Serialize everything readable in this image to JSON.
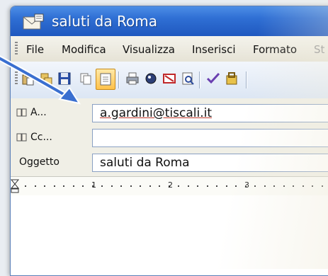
{
  "window": {
    "title": "saluti da Roma"
  },
  "menubar": {
    "items": [
      "File",
      "Modifica",
      "Visualizza",
      "Inserisci",
      "Formato",
      "St"
    ]
  },
  "toolbar": {
    "buttons": [
      "paste-icon",
      "cut-icon",
      "save-icon",
      "copy-icon",
      "attach-icon",
      "print-icon",
      "spell-icon",
      "delete-icon",
      "preview-icon",
      "check-icon",
      "permission-icon"
    ]
  },
  "headers": {
    "to_label": "A...",
    "to_value": "a.gardini@tiscali.it",
    "cc_label": "Cc...",
    "cc_value": "",
    "subject_label": "Oggetto",
    "subject_value": "saluti da Roma"
  },
  "ruler": {
    "numbers": [
      "1",
      "2",
      "3"
    ]
  },
  "colors": {
    "titlebar": "#2f6fd4",
    "active_button": "#ffc24a",
    "arrow": "#3a6fd0"
  }
}
